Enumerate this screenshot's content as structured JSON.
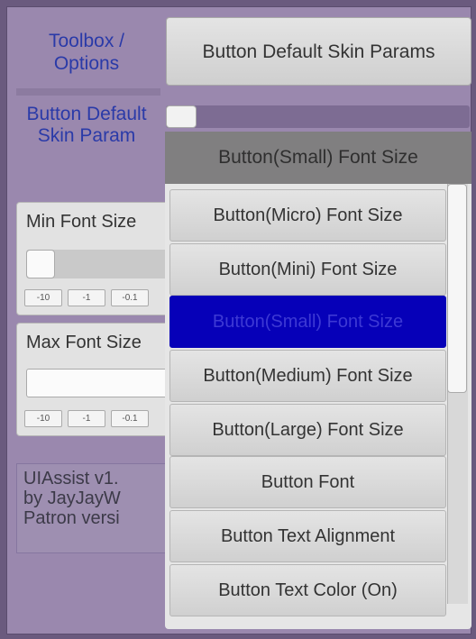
{
  "toolbox_tab": "Toolbox / Options",
  "top_button": "Button Default Skin Params",
  "section_label": "Button Default Skin Param",
  "dropdown": {
    "selected": "Button(Small) Font Size",
    "items": [
      "Button(Micro) Font Size",
      "Button(Mini) Font Size",
      "Button(Small) Font Size",
      "Button(Medium) Font Size",
      "Button(Large) Font Size",
      "Button Font",
      "Button Text Alignment",
      "Button Text Color (On)"
    ]
  },
  "min_font": {
    "title": "Min Font Size",
    "steps": [
      "-10",
      "-1",
      "-0.1"
    ]
  },
  "max_font": {
    "title": "Max Font Size",
    "steps": [
      "-10",
      "-1",
      "-0.1"
    ]
  },
  "info": {
    "line1": "UIAssist v1.",
    "line2": "by JayJayW",
    "line3": "Patron versi"
  },
  "colors": {
    "background": "#9a88ae",
    "label_blue": "#2a3aa8",
    "selected": "#0600b8"
  }
}
